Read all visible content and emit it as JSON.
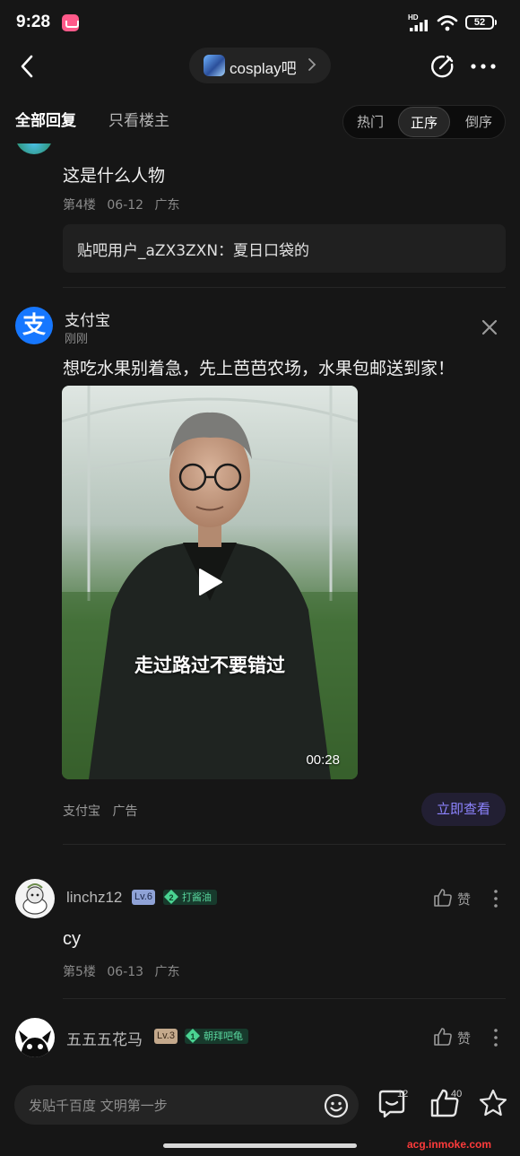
{
  "status_bar": {
    "time": "9:28",
    "network": "HD",
    "battery": "52",
    "icons": [
      "app-notification-icon",
      "signal-icon",
      "wifi-icon",
      "battery-icon"
    ]
  },
  "nav": {
    "forum_name": "cosplay吧",
    "icons": [
      "back-icon",
      "chevron-right-icon",
      "edit-icon",
      "more-icon"
    ]
  },
  "filter": {
    "tabs": [
      "全部回复",
      "只看楼主"
    ],
    "sort_options": [
      "热门",
      "正序",
      "倒序"
    ],
    "active_tab": "全部回复",
    "active_sort": "正序"
  },
  "post4": {
    "text": "这是什么人物",
    "floor": "第4楼",
    "date": "06-12",
    "location": "广东",
    "quote": "贴吧用户_aZX3ZXN：夏日口袋的"
  },
  "ad": {
    "advertiser": "支付宝",
    "logo_char": "支",
    "time": "刚刚",
    "text": "想吃水果别着急，先上芭芭农场，水果包邮送到家！",
    "video_caption": "走过路过不要错过",
    "video_duration": "00:28",
    "source": "支付宝",
    "ad_label": "广告",
    "cta": "立即查看"
  },
  "post5": {
    "username": "linchz12",
    "level": "Lv.6",
    "title_num": "2",
    "title": "打酱油",
    "like_label": "赞",
    "text": "cy",
    "floor": "第5楼",
    "date": "06-13",
    "location": "广东"
  },
  "post6": {
    "username": "五五五花马",
    "level": "Lv.3",
    "title_num": "1",
    "title": "朝拜吧龟",
    "like_label": "赞"
  },
  "bottom_bar": {
    "reply_placeholder": "发贴千百度 文明第一步",
    "comment_count": "12",
    "like_count": "40"
  },
  "watermark": "acg.inmoke.com",
  "colors": {
    "background": "#161616",
    "accent": "#8d84ff",
    "alipay_blue": "#1677ff",
    "title_badge_green": "#58d49c"
  }
}
